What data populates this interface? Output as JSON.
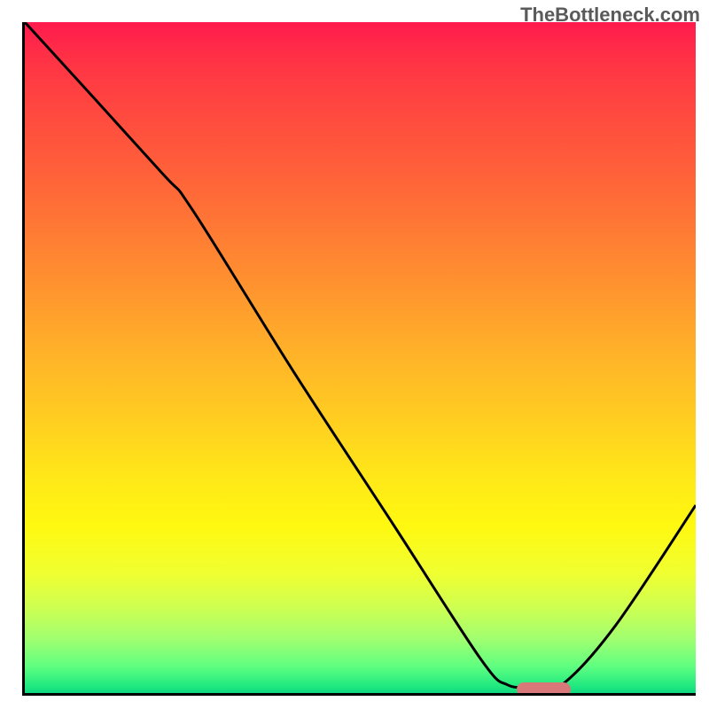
{
  "watermark": "TheBottleneck.com",
  "chart_data": {
    "type": "line",
    "title": "",
    "xlabel": "",
    "ylabel": "",
    "xlim": [
      0,
      100
    ],
    "ylim": [
      0,
      100
    ],
    "curve": [
      {
        "x": 0,
        "y": 100
      },
      {
        "x": 20,
        "y": 78
      },
      {
        "x": 25,
        "y": 72
      },
      {
        "x": 40,
        "y": 48
      },
      {
        "x": 55,
        "y": 25
      },
      {
        "x": 68,
        "y": 5
      },
      {
        "x": 72,
        "y": 1.2
      },
      {
        "x": 76,
        "y": 1.0
      },
      {
        "x": 80,
        "y": 1.2
      },
      {
        "x": 88,
        "y": 10
      },
      {
        "x": 100,
        "y": 28
      }
    ],
    "marker": {
      "x_start": 73,
      "x_end": 81,
      "y": 0.9
    },
    "gradient_stops": [
      {
        "pos": 0,
        "color": "#ff1a4d"
      },
      {
        "pos": 50,
        "color": "#ffb428"
      },
      {
        "pos": 80,
        "color": "#f0ff30"
      },
      {
        "pos": 100,
        "color": "#10d880"
      }
    ]
  }
}
